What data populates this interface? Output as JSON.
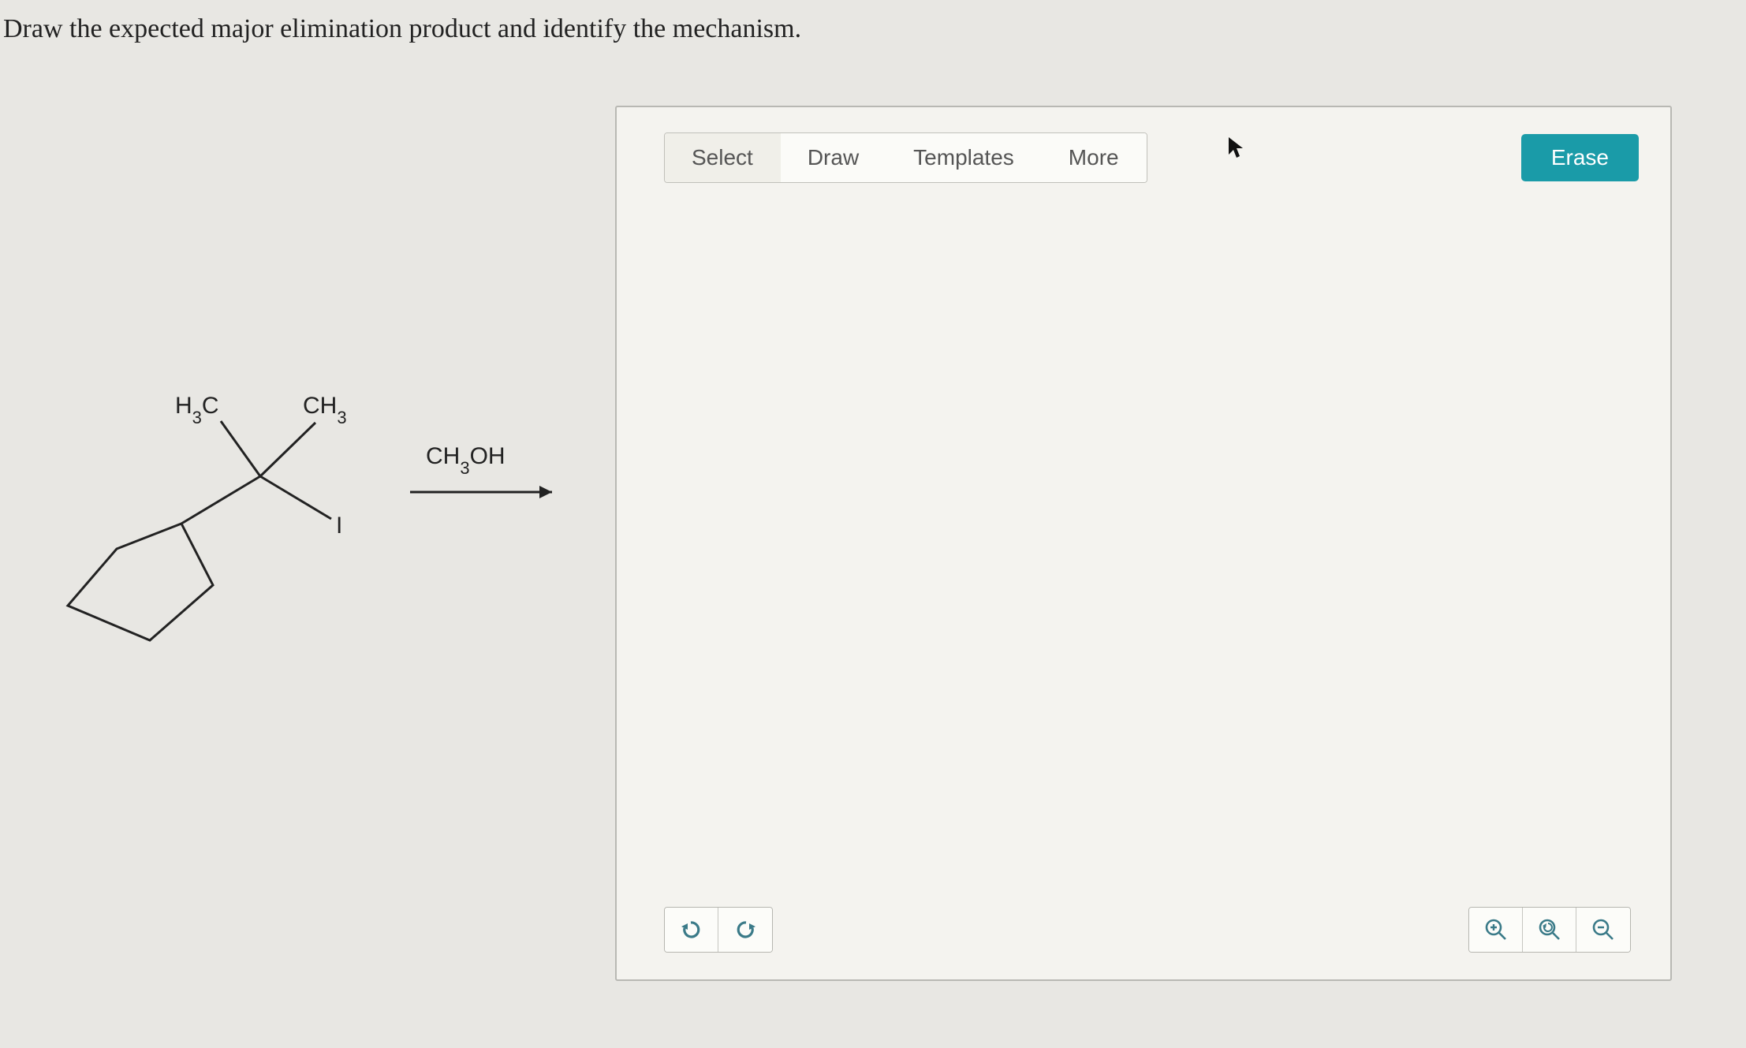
{
  "question": "Draw the expected major elimination product and identify the mechanism.",
  "reactant": {
    "sub1": "H₃C",
    "sub2": "CH₃",
    "leaving": "I",
    "reagent": "CH₃OH"
  },
  "toolbar": {
    "select": "Select",
    "draw": "Draw",
    "templates": "Templates",
    "more": "More",
    "erase": "Erase"
  },
  "icons": {
    "undo": "undo-icon",
    "redo": "redo-icon",
    "zoomin": "zoom-in-icon",
    "reset": "zoom-reset-icon",
    "zoomout": "zoom-out-icon"
  }
}
